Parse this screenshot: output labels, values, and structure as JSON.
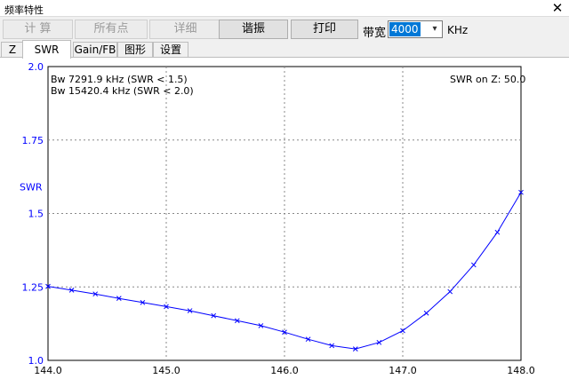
{
  "window": {
    "title": "频率特性",
    "close_glyph": "✕"
  },
  "toolbar": {
    "buttons": [
      {
        "label": "计 算",
        "enabled": false
      },
      {
        "label": "所有点",
        "enabled": false
      },
      {
        "label": "详细",
        "enabled": false
      },
      {
        "label": "谐振",
        "enabled": true
      },
      {
        "label": "打印",
        "enabled": true
      }
    ],
    "bandwidth_label": "带宽",
    "bandwidth_value": "4000",
    "bandwidth_unit": "KHz"
  },
  "tabs": [
    {
      "label": "Z",
      "active": false
    },
    {
      "label": "SWR",
      "active": true
    },
    {
      "label": "Gain/FB",
      "active": false
    },
    {
      "label": "图形",
      "active": false
    },
    {
      "label": "设置",
      "active": false
    }
  ],
  "chart": {
    "bw_line1": "Bw 7291.9 kHz (SWR < 1.5)",
    "bw_line2": "Bw 15420.4 kHz (SWR < 2.0)",
    "swr_on_z": "SWR on Z: 50.0"
  },
  "chart_data": {
    "type": "line",
    "ylabel": "SWR",
    "xlim": [
      144.0,
      148.0
    ],
    "ylim": [
      1.0,
      2.0
    ],
    "x_ticks": [
      "144.0",
      "145.0",
      "146.0",
      "147.0",
      "148.0"
    ],
    "y_ticks": [
      "1.0",
      "1.25",
      "1.5",
      "1.75",
      "2.0"
    ],
    "grid": true,
    "series": [
      {
        "color": "#0000ff",
        "x": [
          144.0,
          144.2,
          144.4,
          144.6,
          144.8,
          145.0,
          145.2,
          145.4,
          145.6,
          145.8,
          146.0,
          146.2,
          146.4,
          146.6,
          146.8,
          147.0,
          147.2,
          147.4,
          147.6,
          147.8,
          148.0
        ],
        "y": [
          1.252,
          1.239,
          1.226,
          1.211,
          1.197,
          1.183,
          1.169,
          1.152,
          1.135,
          1.118,
          1.096,
          1.072,
          1.05,
          1.039,
          1.061,
          1.101,
          1.161,
          1.234,
          1.325,
          1.436,
          1.572
        ]
      }
    ]
  }
}
